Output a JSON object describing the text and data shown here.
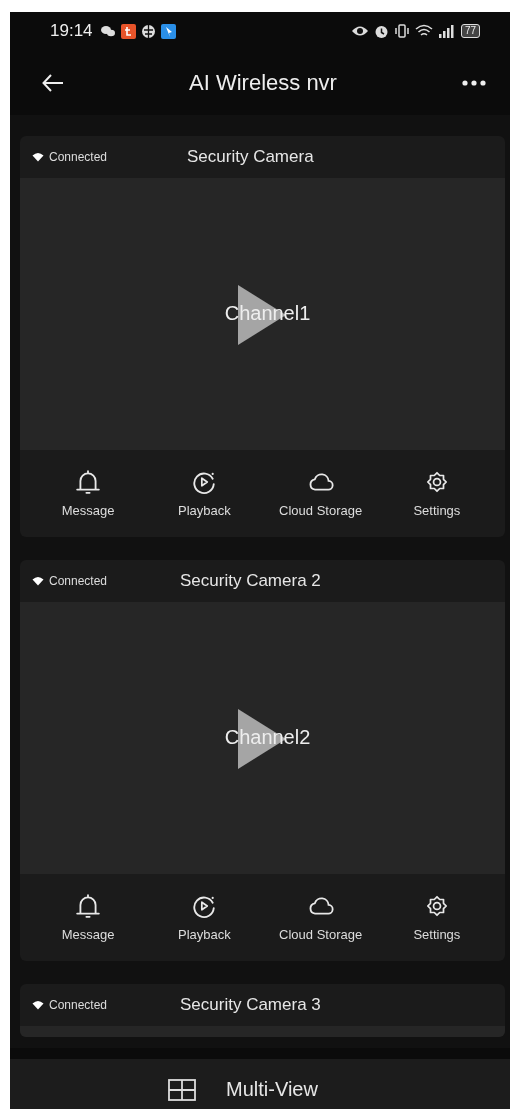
{
  "status_bar": {
    "time": "19:14",
    "battery": "77"
  },
  "app_bar": {
    "title": "AI Wireless nvr"
  },
  "cameras": [
    {
      "status": "Connected",
      "name": "Security Camera",
      "channel": "Channel1",
      "actions": [
        {
          "kind": "bell",
          "label": "Message"
        },
        {
          "kind": "playback",
          "label": "Playback"
        },
        {
          "kind": "cloud",
          "label": "Cloud Storage"
        },
        {
          "kind": "gear",
          "label": "Settings"
        }
      ]
    },
    {
      "status": "Connected",
      "name": "Security Camera 2",
      "channel": "Channel2",
      "actions": [
        {
          "kind": "bell",
          "label": "Message"
        },
        {
          "kind": "playback",
          "label": "Playback"
        },
        {
          "kind": "cloud",
          "label": "Cloud Storage"
        },
        {
          "kind": "gear",
          "label": "Settings"
        }
      ]
    },
    {
      "status": "Connected",
      "name": "Security Camera 3"
    }
  ],
  "bottom_bar": {
    "label": "Multi-View"
  }
}
